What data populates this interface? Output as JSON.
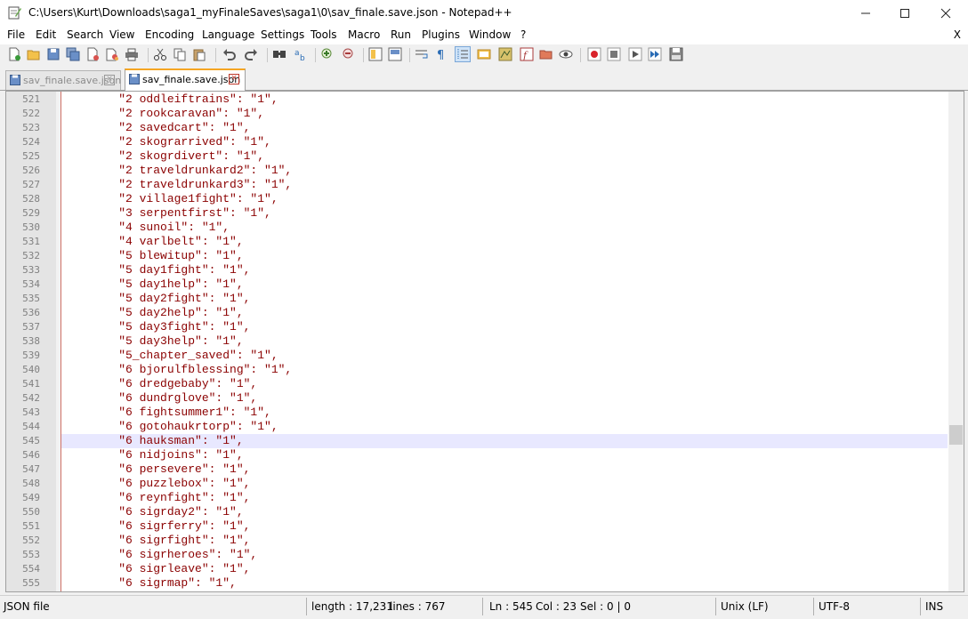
{
  "window": {
    "title": "C:\\Users\\Kurt\\Downloads\\saga1_myFinaleSaves\\saga1\\0\\sav_finale.save.json - Notepad++"
  },
  "menu": {
    "items": [
      "File",
      "Edit",
      "Search",
      "View",
      "Encoding",
      "Language",
      "Settings",
      "Tools",
      "Macro",
      "Run",
      "Plugins",
      "Window",
      "?"
    ],
    "close": "X"
  },
  "tabs": [
    {
      "label": "sav_finale.save.json"
    },
    {
      "label": "sav_finale.save.json"
    }
  ],
  "editor": {
    "current_line": 545,
    "lines": [
      {
        "num": "521",
        "text": "    \"2 oddleiftrains\": \"1\","
      },
      {
        "num": "522",
        "text": "    \"2 rookcaravan\": \"1\","
      },
      {
        "num": "523",
        "text": "    \"2 savedcart\": \"1\","
      },
      {
        "num": "524",
        "text": "    \"2 skograrrived\": \"1\","
      },
      {
        "num": "525",
        "text": "    \"2 skogrdivert\": \"1\","
      },
      {
        "num": "526",
        "text": "    \"2 traveldrunkard2\": \"1\","
      },
      {
        "num": "527",
        "text": "    \"2 traveldrunkard3\": \"1\","
      },
      {
        "num": "528",
        "text": "    \"2 village1fight\": \"1\","
      },
      {
        "num": "529",
        "text": "    \"3 serpentfirst\": \"1\","
      },
      {
        "num": "530",
        "text": "    \"4 sunoil\": \"1\","
      },
      {
        "num": "531",
        "text": "    \"4 varlbelt\": \"1\","
      },
      {
        "num": "532",
        "text": "    \"5 blewitup\": \"1\","
      },
      {
        "num": "533",
        "text": "    \"5 day1fight\": \"1\","
      },
      {
        "num": "534",
        "text": "    \"5 day1help\": \"1\","
      },
      {
        "num": "535",
        "text": "    \"5 day2fight\": \"1\","
      },
      {
        "num": "536",
        "text": "    \"5 day2help\": \"1\","
      },
      {
        "num": "537",
        "text": "    \"5 day3fight\": \"1\","
      },
      {
        "num": "538",
        "text": "    \"5 day3help\": \"1\","
      },
      {
        "num": "539",
        "text": "    \"5_chapter_saved\": \"1\","
      },
      {
        "num": "540",
        "text": "    \"6 bjorulfblessing\": \"1\","
      },
      {
        "num": "541",
        "text": "    \"6 dredgebaby\": \"1\","
      },
      {
        "num": "542",
        "text": "    \"6 dundrglove\": \"1\","
      },
      {
        "num": "543",
        "text": "    \"6 fightsummer1\": \"1\","
      },
      {
        "num": "544",
        "text": "    \"6 gotohaukrtorp\": \"1\","
      },
      {
        "num": "545",
        "text": "    \"6 hauksman\": \"1\","
      },
      {
        "num": "546",
        "text": "    \"6 nidjoins\": \"1\","
      },
      {
        "num": "547",
        "text": "    \"6 persevere\": \"1\","
      },
      {
        "num": "548",
        "text": "    \"6 puzzlebox\": \"1\","
      },
      {
        "num": "549",
        "text": "    \"6 reynfight\": \"1\","
      },
      {
        "num": "550",
        "text": "    \"6 sigrday2\": \"1\","
      },
      {
        "num": "551",
        "text": "    \"6 sigrferry\": \"1\","
      },
      {
        "num": "552",
        "text": "    \"6 sigrfight\": \"1\","
      },
      {
        "num": "553",
        "text": "    \"6 sigrheroes\": \"1\","
      },
      {
        "num": "554",
        "text": "    \"6 sigrleave\": \"1\","
      },
      {
        "num": "555",
        "text": "    \"6 sigrmap\": \"1\","
      }
    ]
  },
  "status": {
    "filetype": "JSON file",
    "length": "length : 17,231",
    "lines": "lines : 767",
    "ln": "Ln : 545",
    "col": "Col : 23",
    "sel": "Sel : 0 | 0",
    "eol": "Unix (LF)",
    "encoding": "UTF-8",
    "mode": "INS"
  },
  "colors": {
    "code_text": "#8b0000",
    "current_line_bg": "#e8e8ff",
    "active_tab_accent": "#f5a623"
  }
}
